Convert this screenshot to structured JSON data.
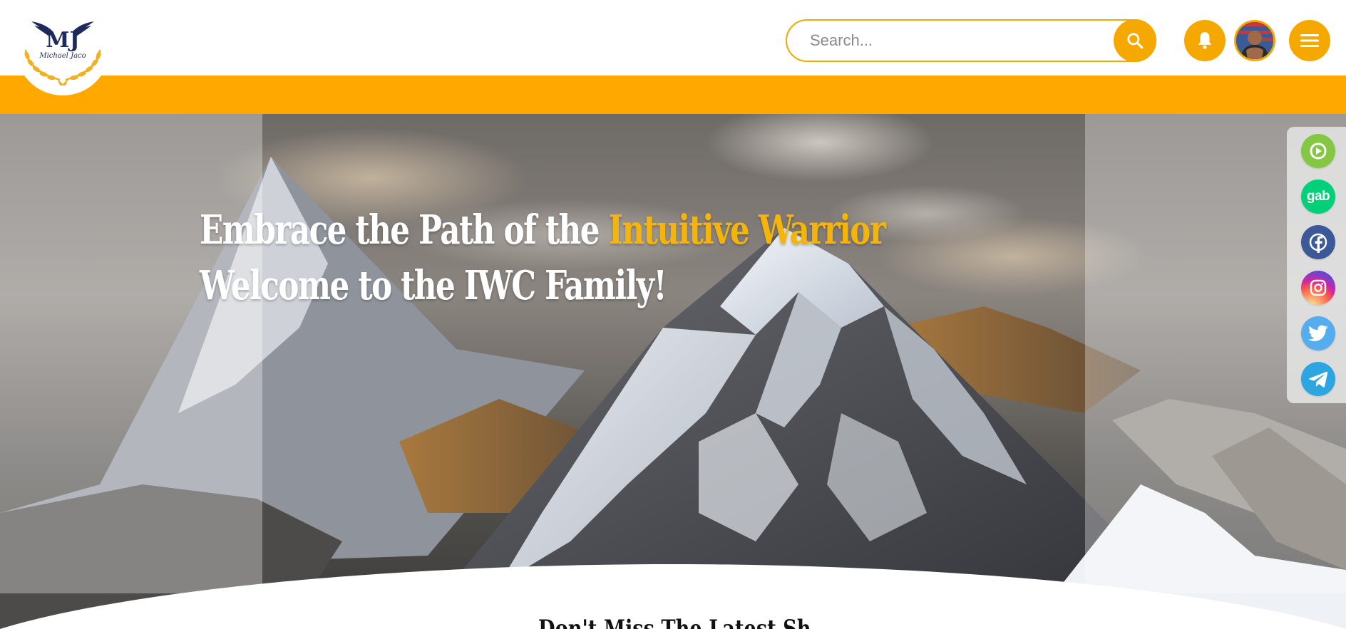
{
  "header": {
    "logo": {
      "monogram": "MJ",
      "script_name": "Michael Jaco",
      "icon": "winged-laurel-logo"
    },
    "search": {
      "placeholder": "Search...",
      "icon": "search-icon"
    },
    "notifications": {
      "icon": "bell-icon"
    },
    "profile": {
      "icon": "user-avatar"
    },
    "menu": {
      "icon": "hamburger-menu-icon"
    }
  },
  "hero": {
    "headline_part1": "Embrace the Path of the ",
    "headline_accent": "Intuitive Warrior",
    "headline_line2": "Welcome to the IWC Family!",
    "teaser": "Don't Miss The Latest Sh"
  },
  "social": [
    {
      "name": "Rumble",
      "icon": "rumble-icon",
      "color": "#85c742"
    },
    {
      "name": "Gab",
      "icon": "gab-icon",
      "label": "gab",
      "color": "#00d178"
    },
    {
      "name": "Facebook",
      "icon": "facebook-icon",
      "color": "#3b5998"
    },
    {
      "name": "Instagram",
      "icon": "instagram-icon",
      "color": "#d6249f"
    },
    {
      "name": "Twitter",
      "icon": "twitter-icon",
      "color": "#55acee"
    },
    {
      "name": "Telegram",
      "icon": "telegram-icon",
      "color": "#2ca5e0"
    }
  ],
  "colors": {
    "accent": "#ffa800",
    "headline_accent": "#f5b40a",
    "logo_navy": "#1d2a5b",
    "logo_gold": "#f2b01e"
  }
}
